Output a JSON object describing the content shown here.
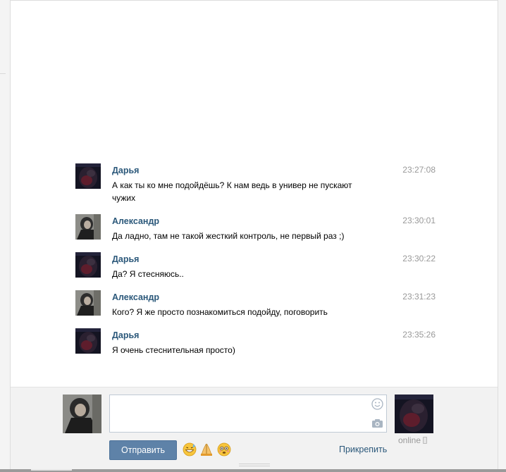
{
  "messages": [
    {
      "author": "Дарья",
      "text": "А как ты ко мне подойдёшь? К нам ведь в универ не пускают чужих",
      "time": "23:27:08",
      "avatar": "darya"
    },
    {
      "author": "Александр",
      "text": "Да ладно, там не такой жесткий контроль, не первый раз ;)",
      "time": "23:30:01",
      "avatar": "alexander"
    },
    {
      "author": "Дарья",
      "text": "Да? Я стесняюсь..",
      "time": "23:30:22",
      "avatar": "darya"
    },
    {
      "author": "Александр",
      "text": "Кого? Я же просто познакомиться подойду, поговорить",
      "time": "23:31:23",
      "avatar": "alexander"
    },
    {
      "author": "Дарья",
      "text": "Я очень стеснительная просто)",
      "time": "23:35:26",
      "avatar": "darya"
    }
  ],
  "composer": {
    "input_value": "",
    "send_label": "Отправить",
    "attach_label": "Прикрепить",
    "peer_status": "online",
    "emoji": [
      "grinning-sweat-emoji",
      "folded-hands-emoji",
      "flushed-face-emoji"
    ]
  },
  "colors": {
    "link": "#2b587a",
    "time": "#999999",
    "button": "#5e82a8",
    "composer_bg": "#f2f2f2"
  }
}
